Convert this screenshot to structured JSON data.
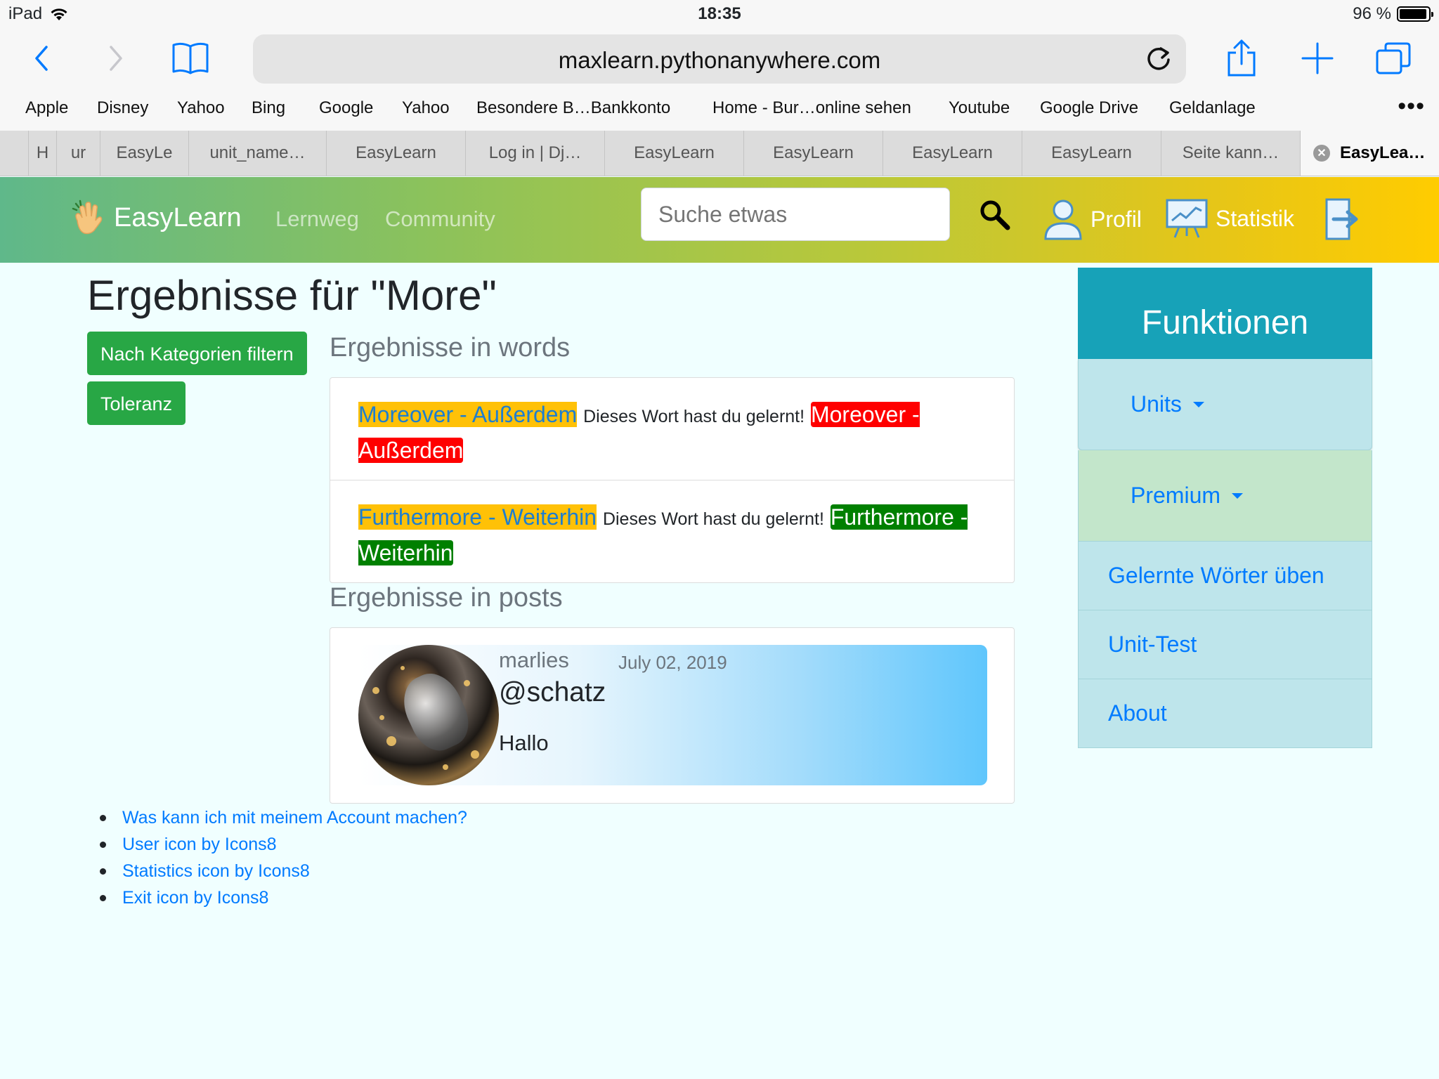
{
  "status_bar": {
    "device": "iPad",
    "time": "18:35",
    "battery": "96 %",
    "battery_level": 0.96
  },
  "browser": {
    "url": "maxlearn.pythonanywhere.com",
    "favorites": [
      "Apple",
      "Disney",
      "Yahoo",
      "Bing",
      "Google",
      "Yahoo",
      "Besondere B…Bankkonto",
      "Home - Bur…online sehen",
      "Youtube",
      "Google Drive",
      "Geldanlage"
    ],
    "more": "•••",
    "tabs": [
      "H",
      "ur",
      "EasyLe",
      "unit_name…",
      "EasyLearn",
      "Log in | Dj…",
      "EasyLearn",
      "EasyLearn",
      "EasyLearn",
      "EasyLearn",
      "Seite kann…"
    ],
    "active_tab": "EasyLea…"
  },
  "navbar": {
    "brand": "EasyLearn",
    "links": [
      "Lernweg",
      "Community"
    ],
    "search_placeholder": "Suche etwas",
    "profile": "Profil",
    "stats": "Statistik"
  },
  "main": {
    "title": "Ergebnisse für \"More\"",
    "filter_button": "Nach Kategorien filtern",
    "tolerance_button": "Toleranz",
    "words_heading": "Ergebnisse in words",
    "words": [
      {
        "word": "Moreover - Außerdem",
        "learned_text": "Dieses Wort hast du gelernt!",
        "badge": "Moreover - Außerdem",
        "badge_color": "#ff0000"
      },
      {
        "word": "Furthermore - Weiterhin",
        "learned_text": "Dieses Wort hast du gelernt!",
        "badge": "Furthermore - Weiterhin",
        "badge_color": "#008000"
      }
    ],
    "posts_heading": "Ergebnisse in posts",
    "post": {
      "author": "marlies",
      "date": "July 02, 2019",
      "title": "@schatz",
      "body": "Hallo"
    },
    "footer_links": [
      "Was kann ich mit meinem Account machen?",
      "User icon by Icons8",
      "Statistics icon by Icons8",
      "Exit icon by Icons8"
    ]
  },
  "sidebar": {
    "title": "Funktionen",
    "dropdowns": [
      "Units",
      "Premium"
    ],
    "links": [
      "Gelernte Wörter üben",
      "Unit-Test",
      "About"
    ]
  },
  "colors": {
    "accent_teal": "#17a2b8",
    "button_green": "#28a745",
    "link_blue": "#007bff"
  }
}
